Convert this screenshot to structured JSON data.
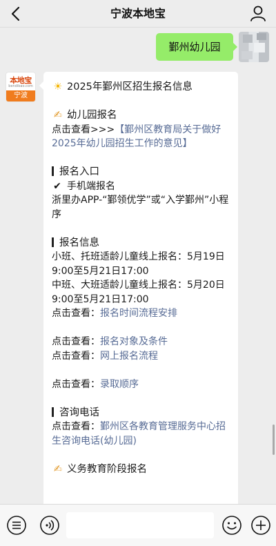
{
  "header": {
    "title": "宁波本地宝"
  },
  "my_message": {
    "text": "鄞州幼儿园"
  },
  "bot": {
    "avatar_logo": "本地宝",
    "avatar_logo_sub": "bendibao.com",
    "avatar_city": "宁波"
  },
  "article": {
    "title": "2025年鄞州区招生报名信息",
    "kindergarten_heading": "幼儿园报名",
    "view_prefix_arrow": "点击查看>>>",
    "policy_link": "【鄞州区教育局关于做好2025年幼儿园招生工作的意见】",
    "entry_heading": "报名入口",
    "mobile_label": "手机端报名",
    "mobile_text": "浙里办APP-“鄞领优学”或“入学鄞州”小程序",
    "info_heading": "报名信息",
    "info_small": "小班、托班适龄儿童线上报名：5月19日9:00至5月21日17:00",
    "info_big": "中班、大班适龄儿童线上报名：5月20日9:00至5月21日17:00",
    "view_prefix": "点击查看：",
    "link_schedule": "报名时间流程安排",
    "link_conditions": "报名对象及条件",
    "link_online_flow": "网上报名流程",
    "link_admission_order": "录取顺序",
    "contact_heading": "咨询电话",
    "link_contact": "鄞州区各教育管理服务中心招生咨询电话(幼儿园)",
    "compulsory_heading": "义务教育阶段报名"
  },
  "input": {
    "placeholder": ""
  },
  "colors": {
    "link": "#576b95",
    "my_bubble": "#95ec69",
    "background": "#ededed"
  },
  "icons": [
    "back-arrow-icon",
    "person-icon",
    "sun-icon",
    "writing-hand-icon",
    "check-mark-icon",
    "menu-list-icon",
    "voice-icon",
    "emoji-icon",
    "plus-icon"
  ]
}
